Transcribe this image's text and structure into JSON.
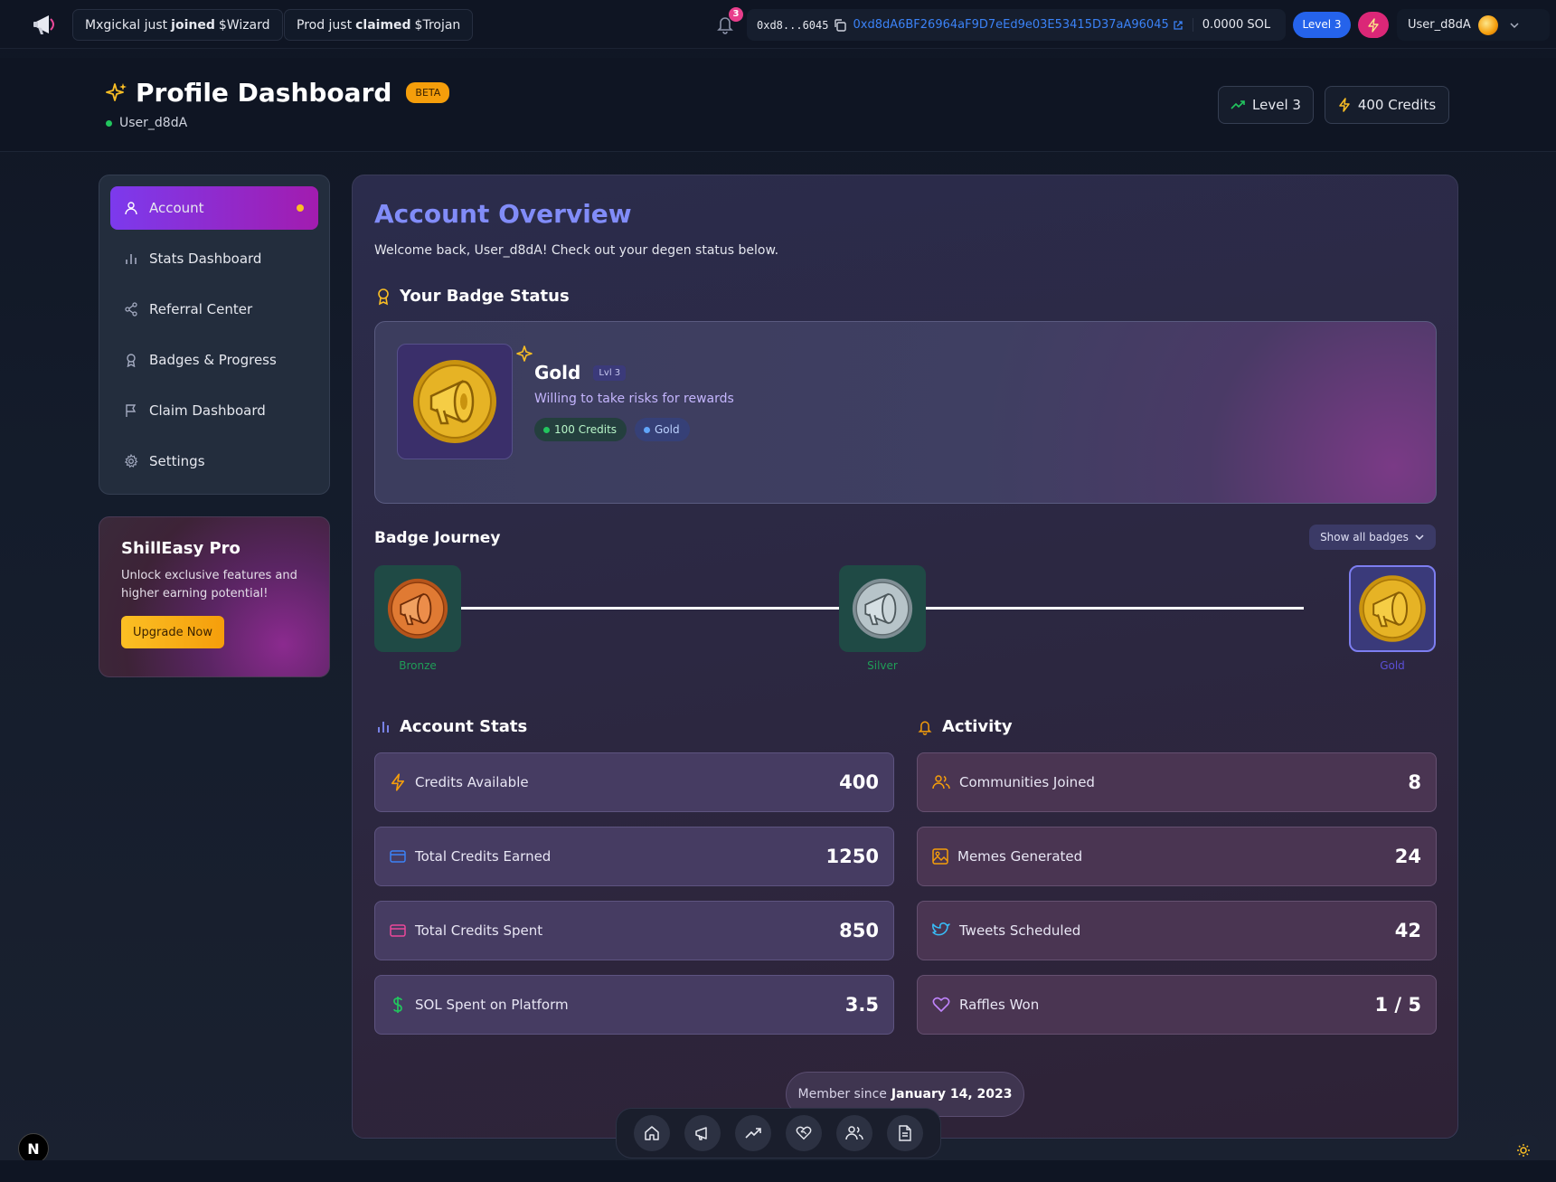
{
  "topbar": {
    "ticker1": {
      "user": "Mxgickal just",
      "action": "joined",
      "token": "$Wizard"
    },
    "ticker2": {
      "user": "Prod just",
      "action": "claimed",
      "token": "$Trojan"
    },
    "notifications": "3",
    "wallet_short": "0xd8...6045",
    "wallet_full": "0xd8dA6BF26964aF9D7eEd9e03E53415D37aA96045",
    "sol_balance": "0.0000 SOL",
    "level": "Level 3",
    "username": "User_d8dA"
  },
  "header": {
    "title": "Profile Dashboard",
    "beta": "BETA",
    "user": "User_d8dA",
    "level": "Level 3",
    "credits": "400 Credits"
  },
  "sidebar": {
    "items": [
      {
        "label": "Account",
        "icon": "user-icon"
      },
      {
        "label": "Stats Dashboard",
        "icon": "bar-chart-icon"
      },
      {
        "label": "Referral Center",
        "icon": "share-icon"
      },
      {
        "label": "Badges & Progress",
        "icon": "award-icon"
      },
      {
        "label": "Claim Dashboard",
        "icon": "flag-icon"
      },
      {
        "label": "Settings",
        "icon": "gear-icon"
      }
    ]
  },
  "promo": {
    "title": "ShillEasy Pro",
    "text": "Unlock exclusive features and higher earning potential!",
    "button": "Upgrade Now"
  },
  "main": {
    "title": "Account Overview",
    "welcome": "Welcome back, User_d8dA! Check out your degen status below.",
    "badge_section": "Your Badge Status",
    "badge": {
      "name": "Gold",
      "level": "Lvl 3",
      "description": "Willing to take risks for rewards",
      "credits_chip": "100 Credits",
      "tier_chip": "Gold"
    },
    "journey": {
      "title": "Badge Journey",
      "show_all": "Show all badges",
      "steps": [
        "Bronze",
        "Silver",
        "Gold"
      ]
    },
    "stats_title": "Account Stats",
    "activity_title": "Activity",
    "stats": [
      {
        "label": "Credits Available",
        "value": "400"
      },
      {
        "label": "Total Credits Earned",
        "value": "1250"
      },
      {
        "label": "Total Credits Spent",
        "value": "850"
      },
      {
        "label": "SOL Spent on Platform",
        "value": "3.5"
      }
    ],
    "activity": [
      {
        "label": "Communities Joined",
        "value": "8"
      },
      {
        "label": "Memes Generated",
        "value": "24"
      },
      {
        "label": "Tweets Scheduled",
        "value": "42"
      },
      {
        "label": "Raffles Won",
        "value": "1 / 5"
      }
    ],
    "member_since_prefix": "Member since",
    "member_since_date": "January 14, 2023"
  },
  "colors": {
    "accent": "#818cf8",
    "active_nav": "#7c3aed",
    "gold": "#f59e0b",
    "pink": "#db2777",
    "blue": "#2563eb"
  },
  "dock_icons": [
    "home-icon",
    "megaphone-icon",
    "trending-icon",
    "heart-handshake-icon",
    "users-icon",
    "document-icon"
  ],
  "fab": {
    "next_badge": "N"
  }
}
